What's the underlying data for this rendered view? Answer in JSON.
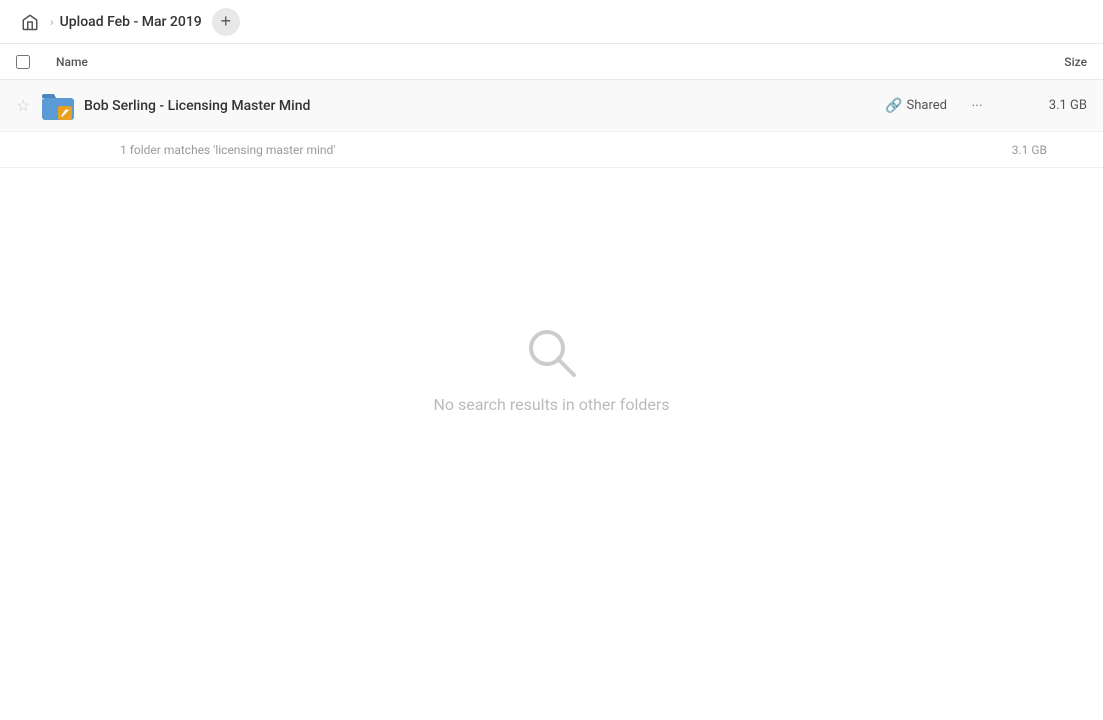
{
  "header": {
    "home_icon": "home",
    "separator": "›",
    "breadcrumb_title": "Upload Feb - Mar 2019",
    "add_button_label": "+"
  },
  "columns": {
    "name_label": "Name",
    "size_label": "Size"
  },
  "result_row": {
    "folder_name": "Bob Serling - Licensing Master Mind",
    "shared_label": "Shared",
    "size": "3.1 GB",
    "more_icon": "···"
  },
  "match_info": {
    "text": "1 folder matches 'licensing master mind'",
    "size": "3.1 GB"
  },
  "empty_state": {
    "text": "No search results in other folders"
  }
}
